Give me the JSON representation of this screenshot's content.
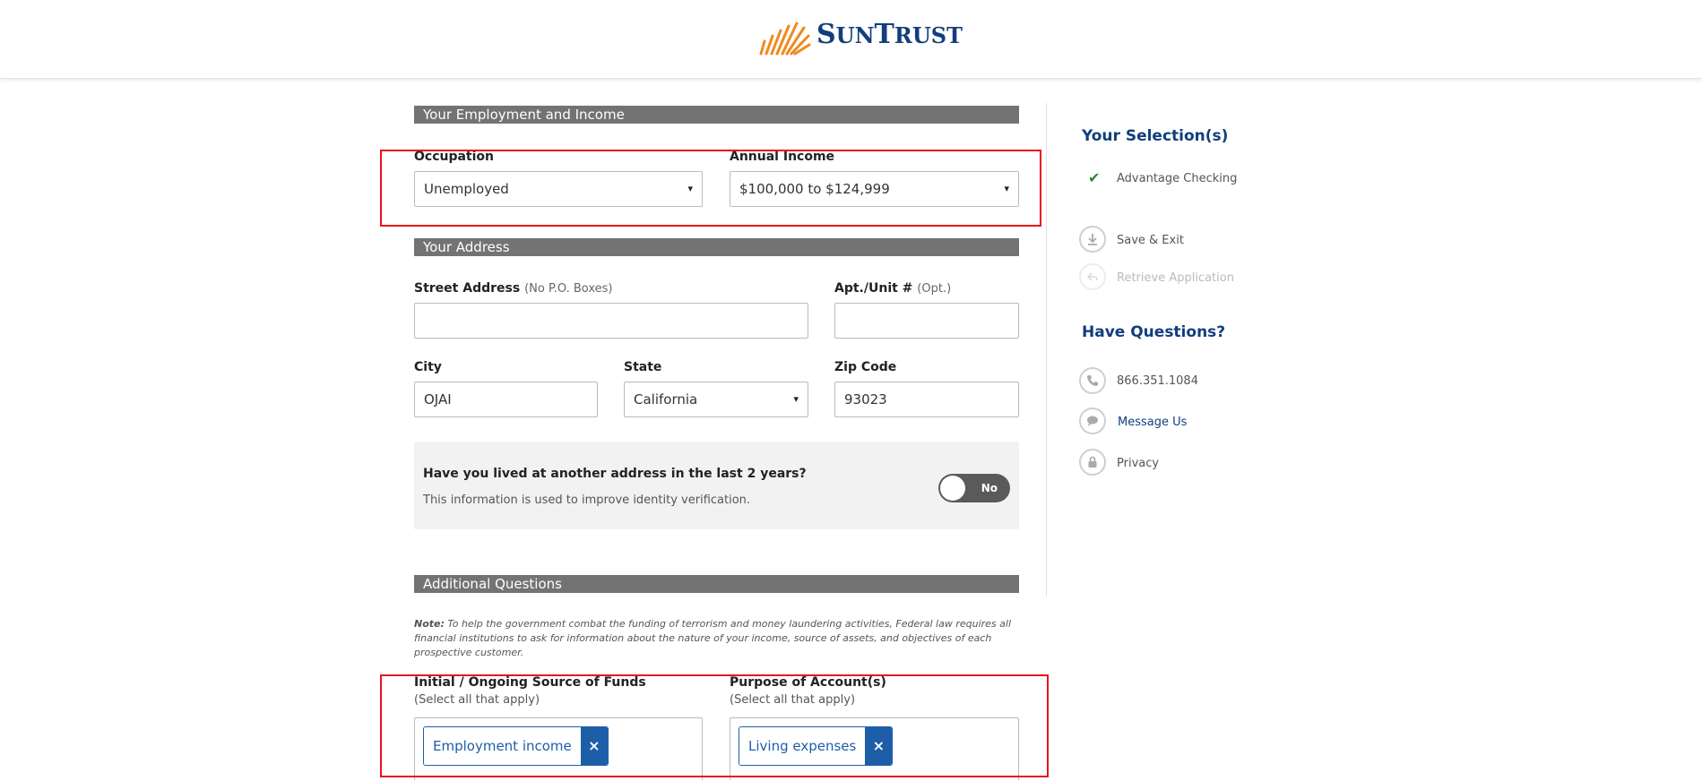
{
  "brand": {
    "name_big": "S",
    "name_rest": "UN",
    "name_big2": "T",
    "name_rest2": "RUST",
    "accent": "#f08a1e",
    "navy": "#123e7c"
  },
  "employment": {
    "section_title": "Your Employment and Income",
    "occupation_label": "Occupation",
    "occupation_value": "Unemployed",
    "income_label": "Annual Income",
    "income_value": "$100,000 to $124,999"
  },
  "address": {
    "section_title": "Your Address",
    "street_label": "Street Address",
    "street_hint": "(No P.O. Boxes)",
    "street_value": "",
    "apt_label": "Apt./Unit #",
    "apt_hint": "(Opt.)",
    "apt_value": "",
    "city_label": "City",
    "city_value": "OJAI",
    "state_label": "State",
    "state_value": "California",
    "zip_label": "Zip Code",
    "zip_value": "93023",
    "prev_question": "Have you lived at another address in the last 2 years?",
    "prev_sub": "This information is used to improve identity verification.",
    "toggle_label": "No"
  },
  "additional": {
    "section_title": "Additional Questions",
    "note_label": "Note:",
    "note_text": " To help the government combat the funding of terrorism and money laundering activities, Federal law requires all financial institutions to ask for information about the nature of your income, source of assets, and objectives of each prospective customer.",
    "funds_label": "Initial / Ongoing Source of Funds",
    "funds_sub": "(Select all that apply)",
    "funds_tag": "Employment income",
    "purpose_label": "Purpose of Account(s)",
    "purpose_sub": "(Select all that apply)",
    "purpose_tag": "Living expenses",
    "tag_remove": "×"
  },
  "sidebar": {
    "selection_title": "Your Selection(s)",
    "selection_item": "Advantage Checking",
    "save_exit": "Save & Exit",
    "retrieve": "Retrieve Application",
    "questions_title": "Have Questions?",
    "phone": "866.351.1084",
    "message": "Message Us",
    "privacy": "Privacy"
  },
  "icons": {
    "caret": "▾",
    "check": "✔"
  },
  "colors": {
    "annotation": "#e8121e",
    "tag_blue": "#1e5ea8",
    "section_bar": "#737373"
  }
}
